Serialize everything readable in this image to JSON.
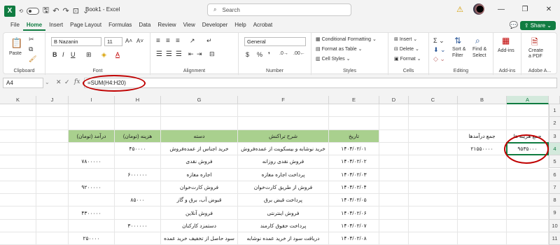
{
  "app": {
    "title": "Book1  -  Excel",
    "search_placeholder": "Search",
    "share_label": "Share"
  },
  "menu": [
    "File",
    "Home",
    "Insert",
    "Page Layout",
    "Formulas",
    "Data",
    "Review",
    "View",
    "Developer",
    "Help",
    "Acrobat"
  ],
  "ribbon": {
    "clipboard": {
      "paste": "Paste",
      "label": "Clipboard"
    },
    "font": {
      "name": "B Nazanin",
      "size": "11",
      "label": "Font"
    },
    "alignment": {
      "label": "Alignment"
    },
    "number": {
      "format": "General",
      "label": "Number"
    },
    "styles": {
      "cond": "Conditional Formatting",
      "table": "Format as Table",
      "cell": "Cell Styles",
      "label": "Styles"
    },
    "cells": {
      "insert": "Insert",
      "delete": "Delete",
      "format": "Format",
      "label": "Cells"
    },
    "editing": {
      "sort": "Sort &",
      "filter": "Filter",
      "find": "Find &",
      "select": "Select",
      "label": "Editing"
    },
    "addins": {
      "addins": "Add-ins",
      "label": "Add-ins"
    },
    "adobe": {
      "create": "Create",
      "pdf": "a PDF",
      "label": "Adobe A..."
    }
  },
  "formula_bar": {
    "name_box": "A4",
    "formula": "=SUM(H4:H20)"
  },
  "columns": [
    "K",
    "J",
    "I",
    "H",
    "G",
    "F",
    "E",
    "D",
    "C",
    "B",
    "A"
  ],
  "rows": [
    "1",
    "2",
    "3",
    "4",
    "5",
    "6",
    "7",
    "8",
    "9",
    "10",
    "11"
  ],
  "sheet": {
    "headers": {
      "income": "درآمد (تومان)",
      "expense": "هزینه (تومان)",
      "category": "دسته",
      "desc": "شرح تراکنش",
      "date": "تاریخ"
    },
    "summary": {
      "b3": "جمع درآمدها",
      "a3": "جمع هزینه ها",
      "b4": "۲۱۵۵۰۰۰۰",
      "a4": "۹۵۳۵۰۰۰"
    },
    "rows": [
      {
        "income": "",
        "expense": "۴۵۰۰۰۰",
        "category": "خرید اجناس از عمده‌فروش",
        "desc": "خرید نوشابه و بیسکویت از عمده‌فروش",
        "date": "۱۴۰۴/۰۲/۰۱"
      },
      {
        "income": "۷۸۰۰۰۰۰",
        "expense": "",
        "category": "فروش نقدی",
        "desc": "فروش نقدی روزانه",
        "date": "۱۴۰۴/۰۲/۰۲"
      },
      {
        "income": "",
        "expense": "۶۰۰۰۰۰۰",
        "category": "اجاره مغازه",
        "desc": "پرداخت اجاره مغازه",
        "date": "۱۴۰۴/۰۲/۰۳"
      },
      {
        "income": "۹۲۰۰۰۰۰",
        "expense": "",
        "category": "فروش کارت‌خوان",
        "desc": "فروش از طریق کارت‌خوان",
        "date": "۱۴۰۴/۰۲/۰۴"
      },
      {
        "income": "",
        "expense": "۸۵۰۰۰",
        "category": "قبوض آب، برق و گاز",
        "desc": "پرداخت قبض برق",
        "date": "۱۴۰۴/۰۲/۰۵"
      },
      {
        "income": "۴۳۰۰۰۰۰",
        "expense": "",
        "category": "فروش آنلاین",
        "desc": "فروش اینترنتی",
        "date": "۱۴۰۴/۰۲/۰۶"
      },
      {
        "income": "",
        "expense": "۳۰۰۰۰۰۰",
        "category": "دستمزد کارکنان",
        "desc": "پرداخت حقوق کارمند",
        "date": "۱۴۰۴/۰۲/۰۷"
      },
      {
        "income": "۲۵۰۰۰۰",
        "expense": "",
        "category": "سود حاصل از تخفیف خرید عمده",
        "desc": "دریافت سود از خرید عمده نوشابه",
        "date": "۱۴۰۴/۰۲/۰۸"
      }
    ]
  },
  "colors": {
    "accent": "#107c41",
    "header_fill": "#a9d08e",
    "annotation": "#c00000"
  }
}
